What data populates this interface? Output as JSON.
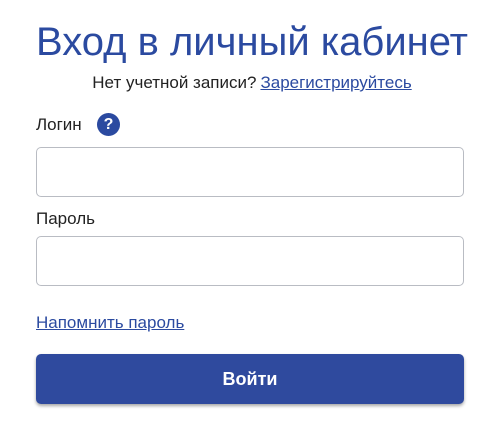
{
  "header": {
    "title": "Вход в личный кабинет",
    "no_account_text": "Нет учетной записи?",
    "register_link": "Зарегистрируйтесь"
  },
  "form": {
    "login_label": "Логин",
    "help_icon": "question-mark-icon",
    "help_symbol": "?",
    "login_value": "",
    "password_label": "Пароль",
    "password_value": "",
    "remind_link": "Напомнить пароль",
    "submit_label": "Войти"
  },
  "colors": {
    "accent": "#2b4aa0",
    "button": "#2f4a9e",
    "input_border": "#b9bcc3"
  }
}
